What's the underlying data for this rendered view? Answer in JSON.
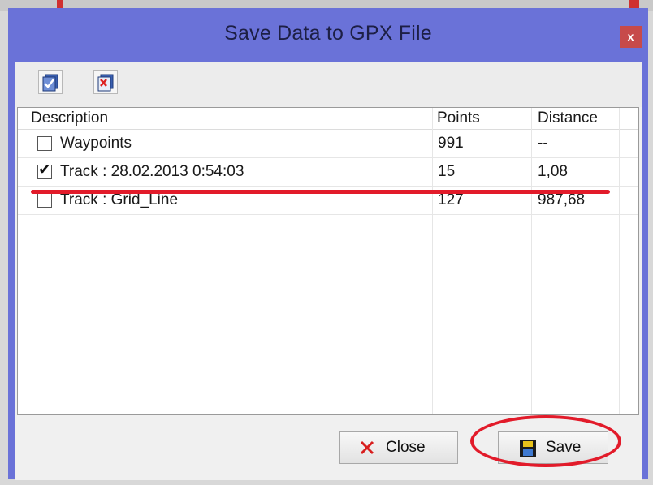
{
  "window": {
    "title": "Save Data to GPX File",
    "close_glyph": "x"
  },
  "toolbar": {
    "buttons": [
      {
        "icon": "check-all-icon"
      },
      {
        "icon": "uncheck-all-icon"
      }
    ]
  },
  "table": {
    "columns": [
      "Description",
      "Points",
      "Distance"
    ],
    "rows": [
      {
        "checked": false,
        "description": "Waypoints",
        "points": "991",
        "distance": "--"
      },
      {
        "checked": true,
        "description": "Track : 28.02.2013 0:54:03",
        "points": "15",
        "distance": "1,08"
      },
      {
        "checked": false,
        "description": "Track : Grid_Line",
        "points": "127",
        "distance": "987,68"
      }
    ]
  },
  "footer": {
    "close_label": "Close",
    "save_label": "Save"
  },
  "colors": {
    "titlebar": "#6a72d8",
    "annotation": "#e21b2a",
    "close_button": "#c74a4a"
  }
}
